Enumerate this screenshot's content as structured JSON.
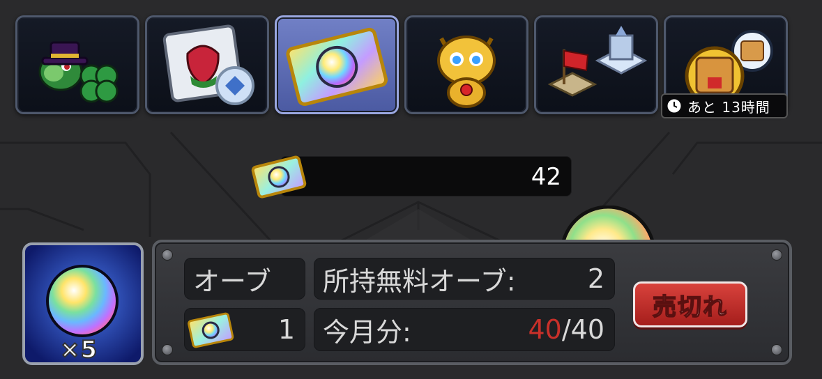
{
  "tabs": [
    {
      "name": "luck",
      "icon": "frog-top-hat-clover-icon",
      "active": false
    },
    {
      "name": "item",
      "icon": "fruit-card-icon",
      "active": false
    },
    {
      "name": "orb-ticket",
      "icon": "rainbow-orb-ticket-icon",
      "active": true
    },
    {
      "name": "monster",
      "icon": "golden-dragon-monster-icon",
      "active": false
    },
    {
      "name": "base",
      "icon": "castle-flag-icon",
      "active": false
    },
    {
      "name": "food",
      "icon": "food-badge-icon",
      "active": false
    }
  ],
  "timer": {
    "label": "あと 13時間"
  },
  "balance": {
    "value": "42"
  },
  "product": {
    "quantity": "×5"
  },
  "panel": {
    "item_name": "オーブ",
    "ticket_cost": "1",
    "free_orbs_label": "所持無料オーブ:",
    "free_orbs_value": "2",
    "monthly_label": "今月分:",
    "monthly_used": "40",
    "monthly_total": "/40",
    "soldout_label": "売切れ"
  },
  "colors": {
    "accent_red": "#c8302a",
    "active_tab": "#6373bd"
  }
}
